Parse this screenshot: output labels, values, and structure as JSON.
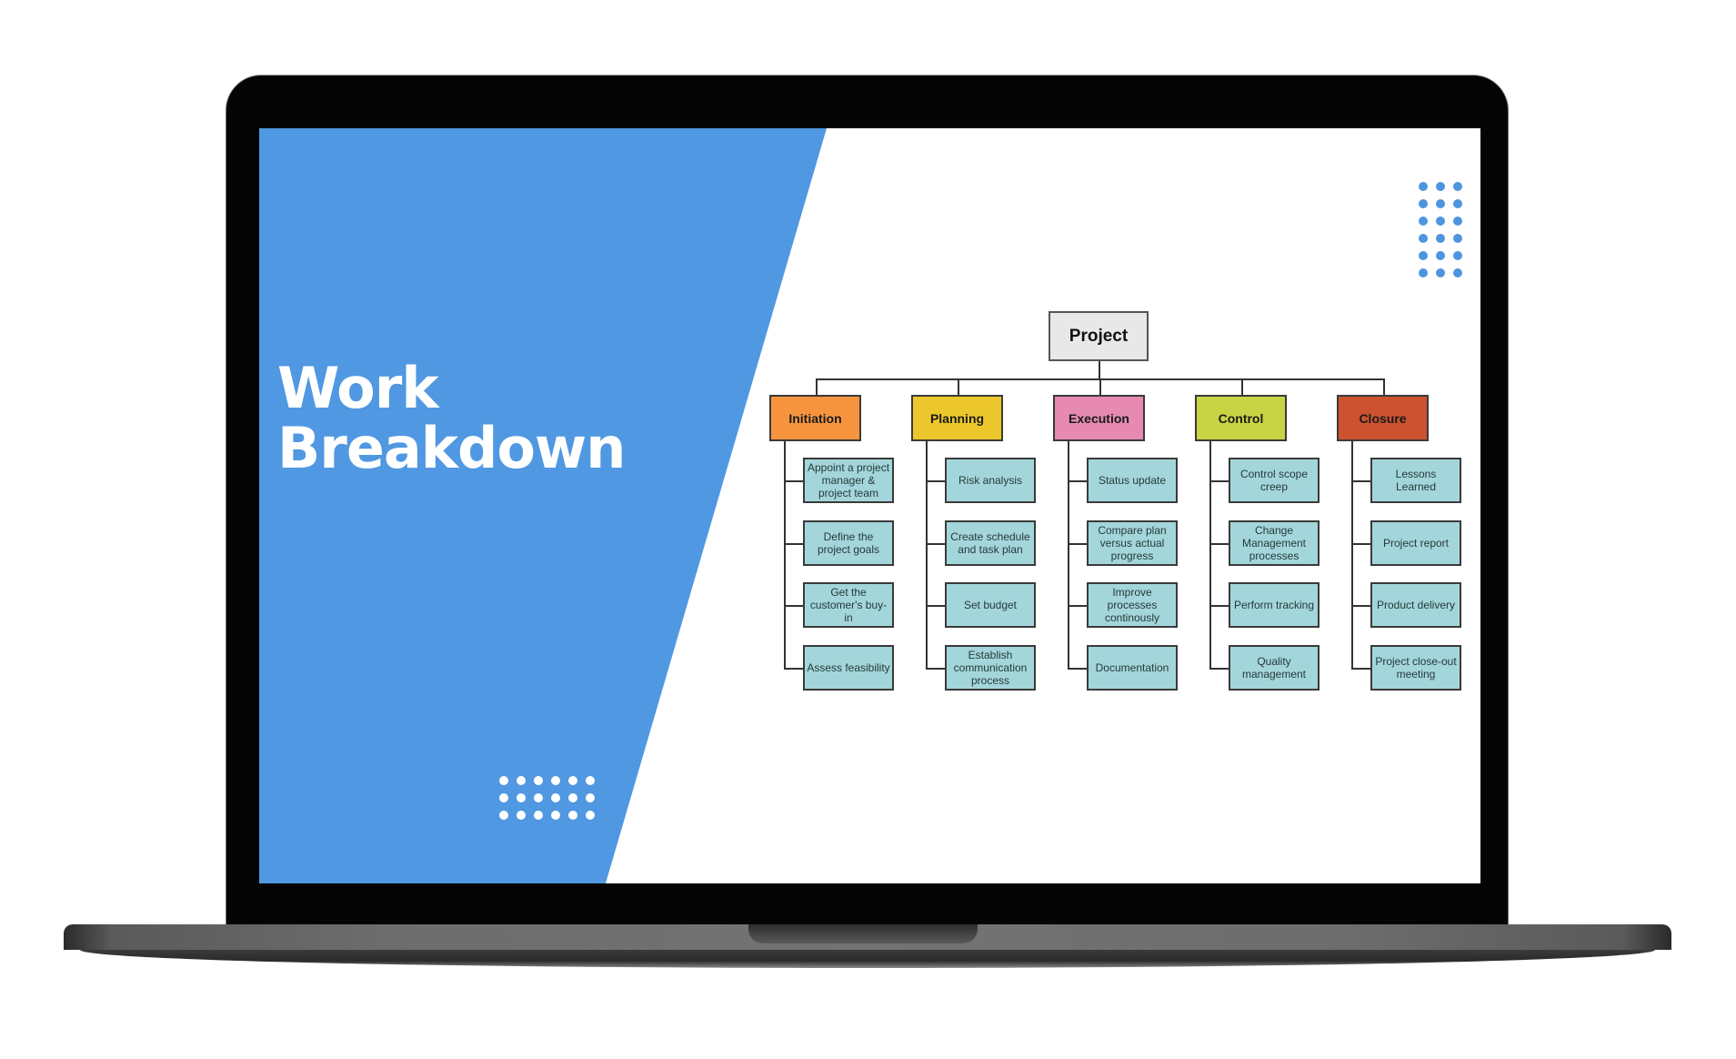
{
  "slide": {
    "title_lines": [
      "Work",
      "Breakdown"
    ],
    "colors": {
      "accent_blue": "#5098e2",
      "dot_white": "#ffffff",
      "dot_blue": "#4e95e0"
    }
  },
  "wbs": {
    "root": "Project",
    "phases": [
      {
        "label": "Initiation",
        "color": "#f7953f",
        "tasks": [
          "Appoint a project manager & project team",
          "Define the project goals",
          "Get the customer's buy-in",
          "Assess feasibility"
        ]
      },
      {
        "label": "Planning",
        "color": "#ecc72b",
        "tasks": [
          "Risk analysis",
          "Create schedule and task plan",
          "Set budget",
          "Establish communication process"
        ]
      },
      {
        "label": "Execution",
        "color": "#e68ab2",
        "tasks": [
          "Status update",
          "Compare plan versus actual progress",
          "Improve processes continously",
          "Documentation"
        ]
      },
      {
        "label": "Control",
        "color": "#c8d443",
        "tasks": [
          "Control scope creep",
          "Change Management processes",
          "Perform tracking",
          "Quality management"
        ]
      },
      {
        "label": "Closure",
        "color": "#cc5230",
        "tasks": [
          "Lessons Learned",
          "Project report",
          "Product delivery",
          "Project close-out meeting"
        ]
      }
    ]
  }
}
